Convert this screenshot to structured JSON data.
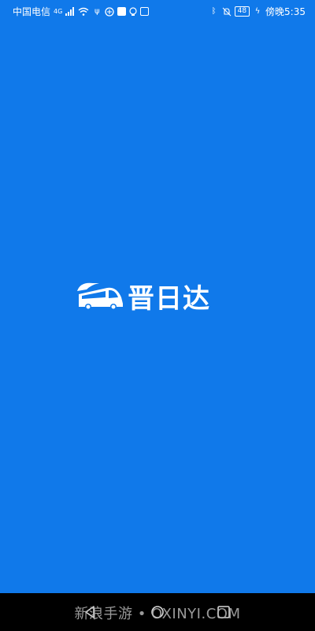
{
  "status_bar": {
    "carrier": "中国电信",
    "network_type": "4G",
    "time": "傍晚5:35",
    "battery_level": "48"
  },
  "splash": {
    "app_name": "晋日达"
  },
  "watermark": {
    "text": "新浪手游 • OXINYI.COM"
  },
  "colors": {
    "background": "#1079ea",
    "nav_bar": "#000000"
  }
}
